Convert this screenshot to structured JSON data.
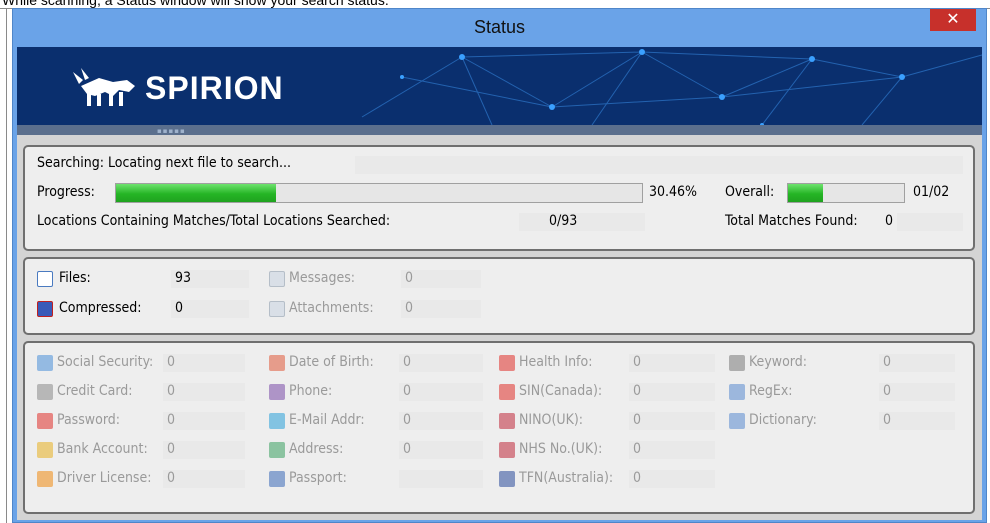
{
  "caption": "While scanning, a Status window will show your search status.",
  "window": {
    "title": "Status",
    "close_glyph": "✕"
  },
  "banner": {
    "logo_text": "SPIRION",
    "strip_dots": "▪▪▪▪▪"
  },
  "progress_panel": {
    "searching_text": "Searching: Locating next file to search...",
    "progress_label": "Progress:",
    "progress_percent": "30.46%",
    "progress_value": 0.3046,
    "overall_label": "Overall:",
    "overall_value": "01/02",
    "overall_fill": 0.3,
    "locations_label": "Locations Containing Matches/Total Locations Searched:",
    "locations_value": "0/93",
    "total_matches_label": "Total Matches Found:",
    "total_matches_value": "0"
  },
  "counts_panel": {
    "files_label": "Files:",
    "files_value": "93",
    "compressed_label": "Compressed:",
    "compressed_value": "0",
    "messages_label": "Messages:",
    "messages_value": "0",
    "attachments_label": "Attachments:",
    "attachments_value": "0"
  },
  "types_panel": {
    "columns": [
      [
        {
          "label": "Social Security:",
          "value": "0",
          "icon": "id-card-icon",
          "color": "#4a8fd8"
        },
        {
          "label": "Credit Card:",
          "value": "0",
          "icon": "credit-card-icon",
          "color": "#8a8a8a"
        },
        {
          "label": "Password:",
          "value": "0",
          "icon": "asterisk-icon",
          "color": "#e0302a"
        },
        {
          "label": "Bank Account:",
          "value": "0",
          "icon": "bank-icon",
          "color": "#e8b020"
        },
        {
          "label": "Driver License:",
          "value": "0",
          "icon": "car-icon",
          "color": "#f08a10"
        }
      ],
      [
        {
          "label": "Date of Birth:",
          "value": "0",
          "icon": "calendar-icon",
          "color": "#e05a3a"
        },
        {
          "label": "Phone:",
          "value": "0",
          "icon": "phone-icon",
          "color": "#7a4aa8"
        },
        {
          "label": "E-Mail Addr:",
          "value": "0",
          "icon": "envelope-icon",
          "color": "#2aa0d8"
        },
        {
          "label": "Address:",
          "value": "0",
          "icon": "house-icon",
          "color": "#3aa060"
        },
        {
          "label": "Passport:",
          "value": "",
          "icon": "globe-icon",
          "color": "#3a6ab8"
        }
      ],
      [
        {
          "label": "Health Info:",
          "value": "0",
          "icon": "health-cross-icon",
          "color": "#e0302a"
        },
        {
          "label": "SIN(Canada):",
          "value": "0",
          "icon": "canada-flag-icon",
          "color": "#e0302a"
        },
        {
          "label": "NINO(UK):",
          "value": "0",
          "icon": "uk-flag-icon",
          "color": "#c0283a"
        },
        {
          "label": "NHS No.(UK):",
          "value": "0",
          "icon": "uk-flag-icon",
          "color": "#c0283a"
        },
        {
          "label": "TFN(Australia):",
          "value": "0",
          "icon": "australia-flag-icon",
          "color": "#2a4a9a"
        }
      ],
      [
        {
          "label": "Keyword:",
          "value": "0",
          "icon": "magnifier-icon",
          "color": "#7a7a7a"
        },
        {
          "label": "RegEx:",
          "value": "0",
          "icon": "regex-icon",
          "color": "#5a8ad0"
        },
        {
          "label": "Dictionary:",
          "value": "0",
          "icon": "dictionary-icon",
          "color": "#5a8ad0"
        }
      ]
    ]
  }
}
